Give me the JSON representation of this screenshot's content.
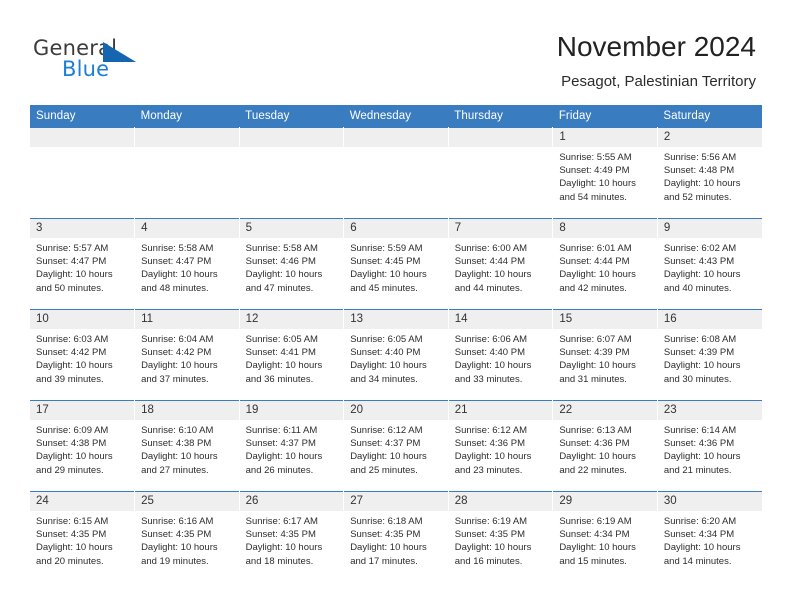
{
  "brand": {
    "name_part1": "General",
    "name_part2": "Blue",
    "flag_icon": "triangle-flag-icon",
    "accent_color": "#1c7fd4"
  },
  "header": {
    "month_title": "November 2024",
    "location": "Pesagot, Palestinian Territory"
  },
  "theme": {
    "header_bg": "#3a7cc0",
    "daynum_bg": "#efefef",
    "grid_line": "#3a7cc0"
  },
  "calendar": {
    "weekday_headers": [
      "Sunday",
      "Monday",
      "Tuesday",
      "Wednesday",
      "Thursday",
      "Friday",
      "Saturday"
    ],
    "weeks": [
      [
        {
          "day": "",
          "empty": true,
          "sunrise": "",
          "sunset": "",
          "daylight": ""
        },
        {
          "day": "",
          "empty": true,
          "sunrise": "",
          "sunset": "",
          "daylight": ""
        },
        {
          "day": "",
          "empty": true,
          "sunrise": "",
          "sunset": "",
          "daylight": ""
        },
        {
          "day": "",
          "empty": true,
          "sunrise": "",
          "sunset": "",
          "daylight": ""
        },
        {
          "day": "",
          "empty": true,
          "sunrise": "",
          "sunset": "",
          "daylight": ""
        },
        {
          "day": "1",
          "empty": false,
          "sunrise": "Sunrise: 5:55 AM",
          "sunset": "Sunset: 4:49 PM",
          "daylight": "Daylight: 10 hours and 54 minutes."
        },
        {
          "day": "2",
          "empty": false,
          "sunrise": "Sunrise: 5:56 AM",
          "sunset": "Sunset: 4:48 PM",
          "daylight": "Daylight: 10 hours and 52 minutes."
        }
      ],
      [
        {
          "day": "3",
          "empty": false,
          "sunrise": "Sunrise: 5:57 AM",
          "sunset": "Sunset: 4:47 PM",
          "daylight": "Daylight: 10 hours and 50 minutes."
        },
        {
          "day": "4",
          "empty": false,
          "sunrise": "Sunrise: 5:58 AM",
          "sunset": "Sunset: 4:47 PM",
          "daylight": "Daylight: 10 hours and 48 minutes."
        },
        {
          "day": "5",
          "empty": false,
          "sunrise": "Sunrise: 5:58 AM",
          "sunset": "Sunset: 4:46 PM",
          "daylight": "Daylight: 10 hours and 47 minutes."
        },
        {
          "day": "6",
          "empty": false,
          "sunrise": "Sunrise: 5:59 AM",
          "sunset": "Sunset: 4:45 PM",
          "daylight": "Daylight: 10 hours and 45 minutes."
        },
        {
          "day": "7",
          "empty": false,
          "sunrise": "Sunrise: 6:00 AM",
          "sunset": "Sunset: 4:44 PM",
          "daylight": "Daylight: 10 hours and 44 minutes."
        },
        {
          "day": "8",
          "empty": false,
          "sunrise": "Sunrise: 6:01 AM",
          "sunset": "Sunset: 4:44 PM",
          "daylight": "Daylight: 10 hours and 42 minutes."
        },
        {
          "day": "9",
          "empty": false,
          "sunrise": "Sunrise: 6:02 AM",
          "sunset": "Sunset: 4:43 PM",
          "daylight": "Daylight: 10 hours and 40 minutes."
        }
      ],
      [
        {
          "day": "10",
          "empty": false,
          "sunrise": "Sunrise: 6:03 AM",
          "sunset": "Sunset: 4:42 PM",
          "daylight": "Daylight: 10 hours and 39 minutes."
        },
        {
          "day": "11",
          "empty": false,
          "sunrise": "Sunrise: 6:04 AM",
          "sunset": "Sunset: 4:42 PM",
          "daylight": "Daylight: 10 hours and 37 minutes."
        },
        {
          "day": "12",
          "empty": false,
          "sunrise": "Sunrise: 6:05 AM",
          "sunset": "Sunset: 4:41 PM",
          "daylight": "Daylight: 10 hours and 36 minutes."
        },
        {
          "day": "13",
          "empty": false,
          "sunrise": "Sunrise: 6:05 AM",
          "sunset": "Sunset: 4:40 PM",
          "daylight": "Daylight: 10 hours and 34 minutes."
        },
        {
          "day": "14",
          "empty": false,
          "sunrise": "Sunrise: 6:06 AM",
          "sunset": "Sunset: 4:40 PM",
          "daylight": "Daylight: 10 hours and 33 minutes."
        },
        {
          "day": "15",
          "empty": false,
          "sunrise": "Sunrise: 6:07 AM",
          "sunset": "Sunset: 4:39 PM",
          "daylight": "Daylight: 10 hours and 31 minutes."
        },
        {
          "day": "16",
          "empty": false,
          "sunrise": "Sunrise: 6:08 AM",
          "sunset": "Sunset: 4:39 PM",
          "daylight": "Daylight: 10 hours and 30 minutes."
        }
      ],
      [
        {
          "day": "17",
          "empty": false,
          "sunrise": "Sunrise: 6:09 AM",
          "sunset": "Sunset: 4:38 PM",
          "daylight": "Daylight: 10 hours and 29 minutes."
        },
        {
          "day": "18",
          "empty": false,
          "sunrise": "Sunrise: 6:10 AM",
          "sunset": "Sunset: 4:38 PM",
          "daylight": "Daylight: 10 hours and 27 minutes."
        },
        {
          "day": "19",
          "empty": false,
          "sunrise": "Sunrise: 6:11 AM",
          "sunset": "Sunset: 4:37 PM",
          "daylight": "Daylight: 10 hours and 26 minutes."
        },
        {
          "day": "20",
          "empty": false,
          "sunrise": "Sunrise: 6:12 AM",
          "sunset": "Sunset: 4:37 PM",
          "daylight": "Daylight: 10 hours and 25 minutes."
        },
        {
          "day": "21",
          "empty": false,
          "sunrise": "Sunrise: 6:12 AM",
          "sunset": "Sunset: 4:36 PM",
          "daylight": "Daylight: 10 hours and 23 minutes."
        },
        {
          "day": "22",
          "empty": false,
          "sunrise": "Sunrise: 6:13 AM",
          "sunset": "Sunset: 4:36 PM",
          "daylight": "Daylight: 10 hours and 22 minutes."
        },
        {
          "day": "23",
          "empty": false,
          "sunrise": "Sunrise: 6:14 AM",
          "sunset": "Sunset: 4:36 PM",
          "daylight": "Daylight: 10 hours and 21 minutes."
        }
      ],
      [
        {
          "day": "24",
          "empty": false,
          "sunrise": "Sunrise: 6:15 AM",
          "sunset": "Sunset: 4:35 PM",
          "daylight": "Daylight: 10 hours and 20 minutes."
        },
        {
          "day": "25",
          "empty": false,
          "sunrise": "Sunrise: 6:16 AM",
          "sunset": "Sunset: 4:35 PM",
          "daylight": "Daylight: 10 hours and 19 minutes."
        },
        {
          "day": "26",
          "empty": false,
          "sunrise": "Sunrise: 6:17 AM",
          "sunset": "Sunset: 4:35 PM",
          "daylight": "Daylight: 10 hours and 18 minutes."
        },
        {
          "day": "27",
          "empty": false,
          "sunrise": "Sunrise: 6:18 AM",
          "sunset": "Sunset: 4:35 PM",
          "daylight": "Daylight: 10 hours and 17 minutes."
        },
        {
          "day": "28",
          "empty": false,
          "sunrise": "Sunrise: 6:19 AM",
          "sunset": "Sunset: 4:35 PM",
          "daylight": "Daylight: 10 hours and 16 minutes."
        },
        {
          "day": "29",
          "empty": false,
          "sunrise": "Sunrise: 6:19 AM",
          "sunset": "Sunset: 4:34 PM",
          "daylight": "Daylight: 10 hours and 15 minutes."
        },
        {
          "day": "30",
          "empty": false,
          "sunrise": "Sunrise: 6:20 AM",
          "sunset": "Sunset: 4:34 PM",
          "daylight": "Daylight: 10 hours and 14 minutes."
        }
      ]
    ]
  }
}
